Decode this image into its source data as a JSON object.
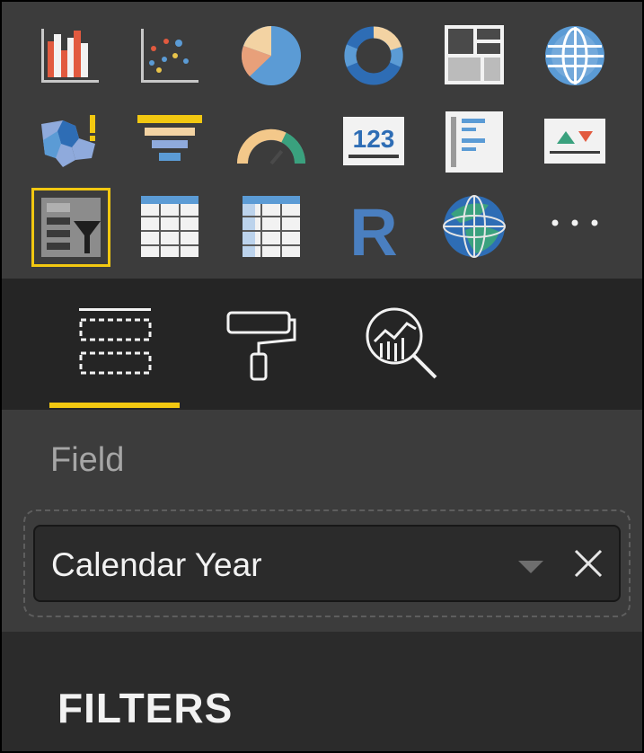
{
  "visualizations": {
    "items": [
      {
        "icon": "ribbon-chart-icon"
      },
      {
        "icon": "scatter-chart-icon"
      },
      {
        "icon": "pie-chart-icon"
      },
      {
        "icon": "donut-chart-icon"
      },
      {
        "icon": "treemap-icon"
      },
      {
        "icon": "map-icon"
      },
      {
        "icon": "filled-map-icon"
      },
      {
        "icon": "funnel-icon"
      },
      {
        "icon": "gauge-icon"
      },
      {
        "icon": "card-icon",
        "text": "123"
      },
      {
        "icon": "multi-row-card-icon"
      },
      {
        "icon": "kpi-icon"
      },
      {
        "icon": "slicer-icon",
        "selected": true
      },
      {
        "icon": "table-icon"
      },
      {
        "icon": "matrix-icon"
      },
      {
        "icon": "r-script-visual-icon",
        "text": "R"
      },
      {
        "icon": "arcgis-map-icon"
      },
      {
        "icon": "more-visuals-icon",
        "text": "···"
      }
    ]
  },
  "pane_tabs": [
    {
      "icon": "fields-icon",
      "active": true
    },
    {
      "icon": "format-paint-roller-icon",
      "active": false
    },
    {
      "icon": "analytics-icon",
      "active": false
    }
  ],
  "field_well": {
    "label": "Field",
    "value": "Calendar Year"
  },
  "filters": {
    "title": "FILTERS"
  },
  "colors": {
    "accent": "#f2c811",
    "gallery_bg": "#3c3c3c",
    "tab_bar_bg": "#252525",
    "blue": "#5b9bd5",
    "orange": "#e8a07a",
    "green": "#3aa17e"
  }
}
